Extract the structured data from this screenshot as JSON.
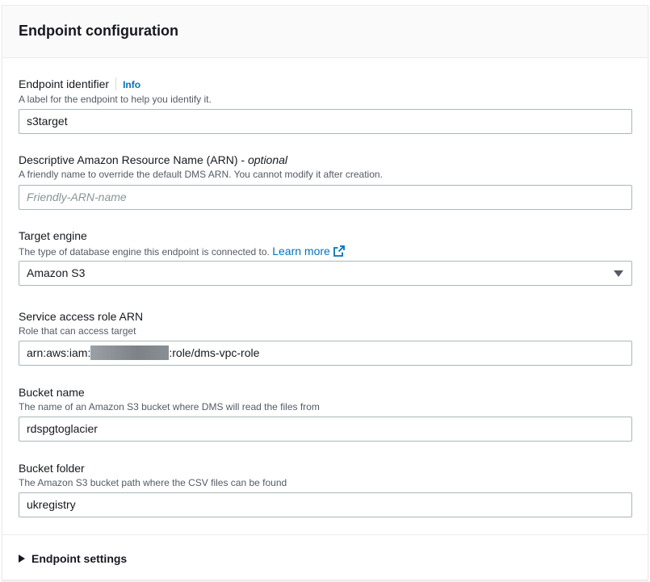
{
  "header": {
    "title": "Endpoint configuration"
  },
  "fields": {
    "identifier": {
      "label": "Endpoint identifier",
      "info": "Info",
      "description": "A label for the endpoint to help you identify it.",
      "value": "s3target"
    },
    "arn": {
      "label": "Descriptive Amazon Resource Name (ARN) - ",
      "optional": "optional",
      "description": "A friendly name to override the default DMS ARN. You cannot modify it after creation.",
      "placeholder": "Friendly-ARN-name"
    },
    "engine": {
      "label": "Target engine",
      "description": "The type of database engine this endpoint is connected to. ",
      "learn_more": "Learn more",
      "value": "Amazon S3"
    },
    "role": {
      "label": "Service access role ARN",
      "description": "Role that can access target",
      "value_prefix": "arn:aws:iam:",
      "value_suffix": ":role/dms-vpc-role"
    },
    "bucket": {
      "label": "Bucket name",
      "description": "The name of an Amazon S3 bucket where DMS will read the files from",
      "value": "rdspgtoglacier"
    },
    "folder": {
      "label": "Bucket folder",
      "description": "The Amazon S3 bucket path where the CSV files can be found",
      "value": "ukregistry"
    }
  },
  "expander": {
    "label": "Endpoint settings"
  },
  "icons": {
    "external": "external-link-icon",
    "caret": "caret-down-icon",
    "expand": "caret-right-icon",
    "redaction": "redacted-account-id"
  },
  "colors": {
    "link": "#0073bb",
    "text": "#16191f",
    "secondary": "#545b64",
    "border": "#aab7b8"
  }
}
